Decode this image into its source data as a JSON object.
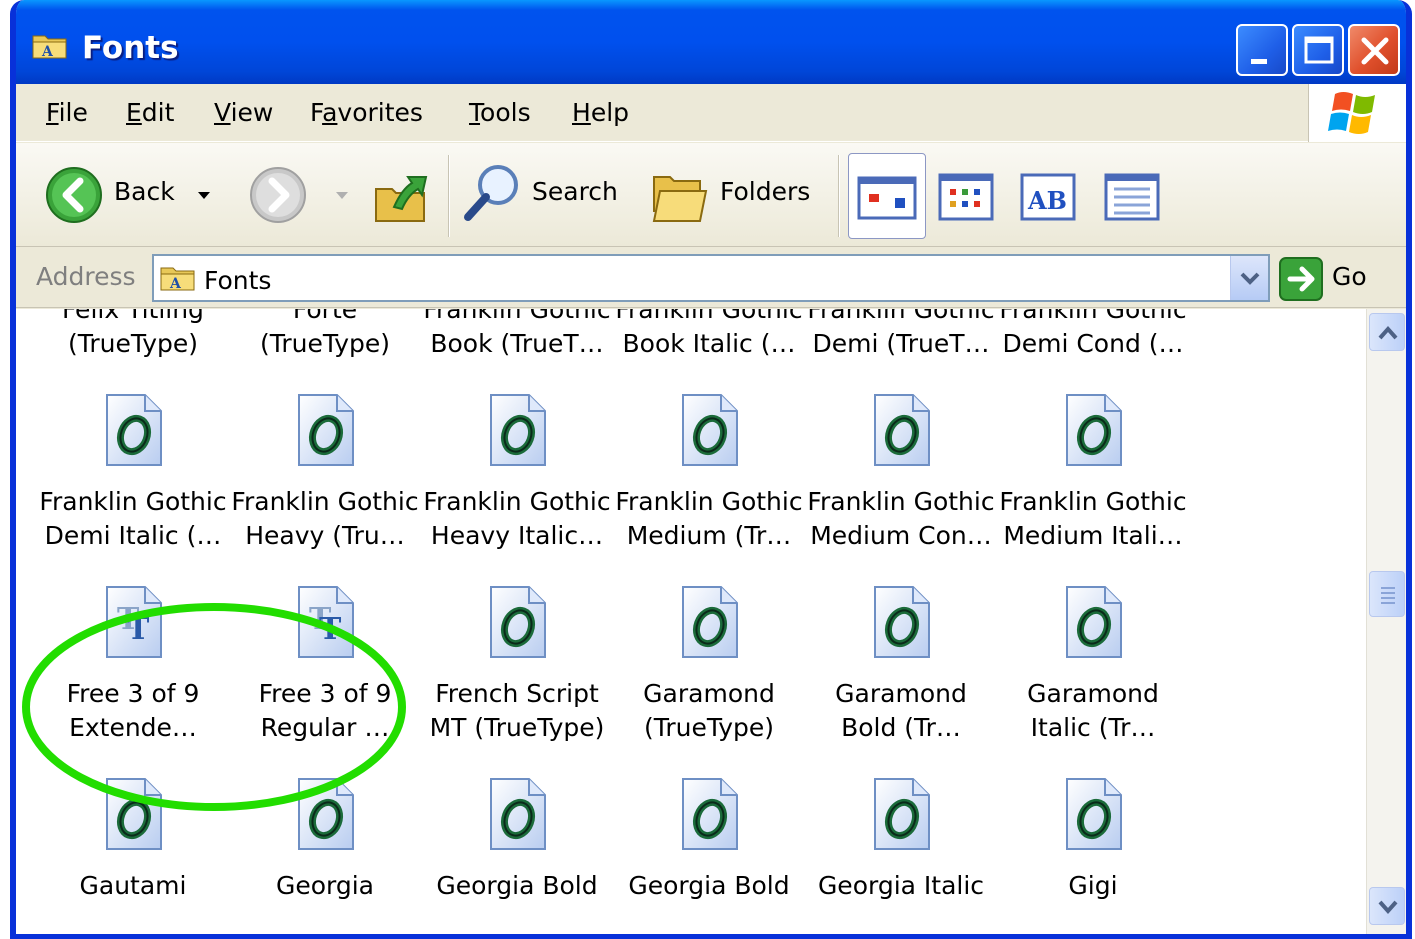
{
  "window": {
    "title": "Fonts",
    "icon": "folder-fonts-icon"
  },
  "menu": {
    "items": [
      {
        "pre": "",
        "u": "F",
        "post": "ile"
      },
      {
        "pre": "",
        "u": "E",
        "post": "dit"
      },
      {
        "pre": "",
        "u": "V",
        "post": "iew"
      },
      {
        "pre": "F",
        "u": "a",
        "post": "vorites"
      },
      {
        "pre": "",
        "u": "T",
        "post": "ools"
      },
      {
        "pre": "",
        "u": "H",
        "post": "elp"
      }
    ]
  },
  "toolbar": {
    "back_label": "Back",
    "search_label": "Search",
    "folders_label": "Folders"
  },
  "address": {
    "label": "Address",
    "value": "Fonts",
    "go_label": "Go"
  },
  "files": {
    "rows": [
      [
        {
          "line1": "Felix Titling",
          "line2": "(TrueType)",
          "icon": "opentype-font-icon"
        },
        {
          "line1": "Forte",
          "line2": "(TrueType)",
          "icon": "opentype-font-icon"
        },
        {
          "line1": "Franklin Gothic",
          "line2": "Book (TrueT…",
          "icon": "opentype-font-icon"
        },
        {
          "line1": "Franklin Gothic",
          "line2": "Book Italic (…",
          "icon": "opentype-font-icon"
        },
        {
          "line1": "Franklin Gothic",
          "line2": "Demi (TrueT…",
          "icon": "opentype-font-icon"
        },
        {
          "line1": "Franklin Gothic",
          "line2": "Demi Cond (…",
          "icon": "opentype-font-icon"
        }
      ],
      [
        {
          "line1": "Franklin Gothic",
          "line2": "Demi Italic (…",
          "icon": "opentype-font-icon"
        },
        {
          "line1": "Franklin Gothic",
          "line2": "Heavy (Tru…",
          "icon": "opentype-font-icon"
        },
        {
          "line1": "Franklin Gothic",
          "line2": "Heavy Italic…",
          "icon": "opentype-font-icon"
        },
        {
          "line1": "Franklin Gothic",
          "line2": "Medium (Tr…",
          "icon": "opentype-font-icon"
        },
        {
          "line1": "Franklin Gothic",
          "line2": "Medium Con…",
          "icon": "opentype-font-icon"
        },
        {
          "line1": "Franklin Gothic",
          "line2": "Medium Itali…",
          "icon": "opentype-font-icon"
        }
      ],
      [
        {
          "line1": "Free 3 of 9",
          "line2": "Extende…",
          "icon": "truetype-font-icon"
        },
        {
          "line1": "Free 3 of 9",
          "line2": "Regular …",
          "icon": "truetype-font-icon"
        },
        {
          "line1": "French Script",
          "line2": "MT (TrueType)",
          "icon": "opentype-font-icon"
        },
        {
          "line1": "Garamond",
          "line2": "(TrueType)",
          "icon": "opentype-font-icon"
        },
        {
          "line1": "Garamond",
          "line2": "Bold (Tr…",
          "icon": "opentype-font-icon"
        },
        {
          "line1": "Garamond",
          "line2": "Italic (Tr…",
          "icon": "opentype-font-icon"
        }
      ],
      [
        {
          "line1": "Gautami",
          "line2": "",
          "icon": "opentype-font-icon"
        },
        {
          "line1": "Georgia",
          "line2": "",
          "icon": "opentype-font-icon"
        },
        {
          "line1": "Georgia Bold",
          "line2": "",
          "icon": "opentype-font-icon"
        },
        {
          "line1": "Georgia Bold",
          "line2": "",
          "icon": "opentype-font-icon"
        },
        {
          "line1": "Georgia Italic",
          "line2": "",
          "icon": "opentype-font-icon"
        },
        {
          "line1": "Gigi",
          "line2": "",
          "icon": "opentype-font-icon"
        }
      ]
    ]
  },
  "highlight": {
    "color": "#22dd00",
    "target": "Free 3 of 9 fonts"
  }
}
